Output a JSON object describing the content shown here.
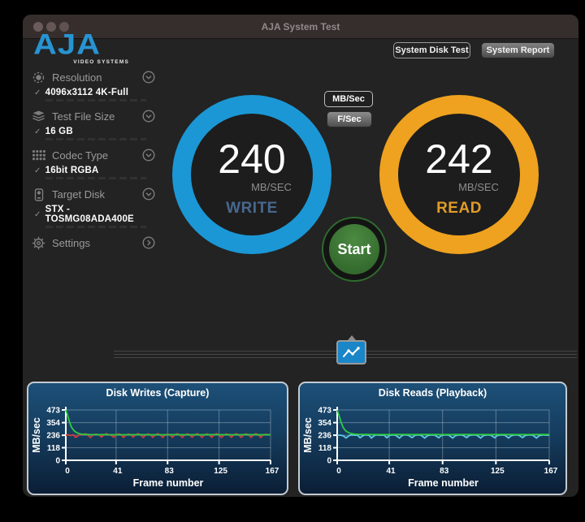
{
  "window": {
    "title": "AJA System Test"
  },
  "brand": {
    "name": "AJA",
    "tagline": "VIDEO SYSTEMS"
  },
  "header": {
    "system_disk_test_label": "System Disk Test",
    "system_report_label": "System Report"
  },
  "icons": {
    "check_glyph": "✓"
  },
  "sidebar": {
    "items": [
      {
        "label": "Resolution",
        "icon": "chip-icon",
        "value": "4096x3112 4K-Full",
        "chevron": "down"
      },
      {
        "label": "Test File Size",
        "icon": "layers-icon",
        "value": "16 GB",
        "chevron": "down"
      },
      {
        "label": "Codec Type",
        "icon": "grid-icon",
        "value": "16bit RGBA",
        "chevron": "down"
      },
      {
        "label": "Target Disk",
        "icon": "disk-icon",
        "value": "STX - TOSMG08ADA400E",
        "chevron": "down"
      },
      {
        "label": "Settings",
        "icon": "gear-icon",
        "value": null,
        "chevron": "right"
      }
    ]
  },
  "unit_buttons": {
    "mbsec_label": "MB/Sec",
    "fsec_label": "F/Sec"
  },
  "gauges": {
    "write": {
      "value": "240",
      "unit": "MB/SEC",
      "label": "WRITE",
      "ring_color": "#1b97d5",
      "label_color": "#47688f"
    },
    "read": {
      "value": "242",
      "unit": "MB/SEC",
      "label": "READ",
      "ring_color": "#efa21f",
      "label_color": "#e09c28"
    }
  },
  "start_button": {
    "label": "Start",
    "color": "#3e7c36"
  },
  "chart_data": [
    {
      "type": "line",
      "title": "Disk Writes (Capture)",
      "xlabel": "Frame number",
      "ylabel": "MB/sec",
      "xlim": [
        0,
        167
      ],
      "ylim": [
        0,
        473
      ],
      "xticks": [
        0,
        41,
        83,
        125,
        167
      ],
      "yticks": [
        0,
        118,
        236,
        354,
        473
      ],
      "grid": true,
      "legend": "none",
      "series": [
        {
          "name": "write-instant",
          "color": "#d03a3a",
          "points": [
            [
              0,
              236
            ],
            [
              2,
              240
            ],
            [
              4,
              233
            ],
            [
              6,
              241
            ],
            [
              8,
              214
            ],
            [
              10,
              231
            ],
            [
              12,
              243
            ],
            [
              14,
              238
            ],
            [
              16,
              250
            ],
            [
              18,
              236
            ],
            [
              20,
              214
            ],
            [
              22,
              236
            ],
            [
              24,
              246
            ],
            [
              27,
              240
            ],
            [
              29,
              218
            ],
            [
              31,
              238
            ],
            [
              33,
              250
            ],
            [
              35,
              240
            ],
            [
              37,
              235
            ],
            [
              39,
              216
            ],
            [
              41,
              238
            ],
            [
              43,
              249
            ],
            [
              45,
              241
            ],
            [
              47,
              214
            ],
            [
              49,
              236
            ],
            [
              51,
              248
            ],
            [
              53,
              239
            ],
            [
              55,
              218
            ],
            [
              57,
              241
            ],
            [
              59,
              250
            ],
            [
              61,
              238
            ],
            [
              63,
              214
            ],
            [
              65,
              236
            ],
            [
              67,
              248
            ],
            [
              69,
              240
            ],
            [
              71,
              216
            ],
            [
              73,
              238
            ],
            [
              75,
              250
            ],
            [
              77,
              239
            ],
            [
              79,
              214
            ],
            [
              81,
              236
            ],
            [
              83,
              248
            ],
            [
              85,
              238
            ],
            [
              87,
              216
            ],
            [
              89,
              240
            ],
            [
              91,
              250
            ],
            [
              93,
              238
            ],
            [
              95,
              214
            ],
            [
              97,
              238
            ],
            [
              99,
              248
            ],
            [
              101,
              240
            ],
            [
              103,
              216
            ],
            [
              105,
              238
            ],
            [
              107,
              250
            ],
            [
              109,
              239
            ],
            [
              111,
              214
            ],
            [
              113,
              238
            ],
            [
              115,
              248
            ],
            [
              117,
              238
            ],
            [
              119,
              216
            ],
            [
              121,
              240
            ],
            [
              123,
              250
            ],
            [
              125,
              238
            ],
            [
              127,
              214
            ],
            [
              129,
              238
            ],
            [
              131,
              248
            ],
            [
              133,
              240
            ],
            [
              135,
              216
            ],
            [
              137,
              238
            ],
            [
              139,
              250
            ],
            [
              141,
              238
            ],
            [
              143,
              214
            ],
            [
              145,
              238
            ],
            [
              147,
              248
            ],
            [
              149,
              240
            ],
            [
              151,
              216
            ],
            [
              153,
              238
            ],
            [
              155,
              250
            ],
            [
              157,
              240
            ],
            [
              159,
              214
            ],
            [
              161,
              238
            ],
            [
              163,
              246
            ],
            [
              165,
              240
            ],
            [
              167,
              238
            ]
          ]
        },
        {
          "name": "write-average",
          "color": "#2ecc40",
          "points": [
            [
              0,
              473
            ],
            [
              1,
              440
            ],
            [
              2,
              400
            ],
            [
              3,
              362
            ],
            [
              4,
              330
            ],
            [
              5,
              305
            ],
            [
              6,
              288
            ],
            [
              7,
              275
            ],
            [
              8,
              266
            ],
            [
              10,
              254
            ],
            [
              12,
              248
            ],
            [
              14,
              245
            ],
            [
              17,
              243
            ],
            [
              20,
              242
            ],
            [
              25,
              241
            ],
            [
              30,
              241
            ],
            [
              40,
              240
            ],
            [
              50,
              240
            ],
            [
              60,
              241
            ],
            [
              70,
              240
            ],
            [
              80,
              240
            ],
            [
              90,
              241
            ],
            [
              100,
              240
            ],
            [
              110,
              240
            ],
            [
              120,
              241
            ],
            [
              130,
              240
            ],
            [
              140,
              240
            ],
            [
              150,
              241
            ],
            [
              160,
              240
            ],
            [
              167,
              240
            ]
          ]
        }
      ]
    },
    {
      "type": "line",
      "title": "Disk Reads (Playback)",
      "xlabel": "Frame number",
      "ylabel": "MB/sec",
      "xlim": [
        0,
        167
      ],
      "ylim": [
        0,
        473
      ],
      "xticks": [
        0,
        41,
        83,
        125,
        167
      ],
      "yticks": [
        0,
        118,
        236,
        354,
        473
      ],
      "grid": true,
      "legend": "none",
      "series": [
        {
          "name": "read-instant",
          "color": "#5fc8e8",
          "points": [
            [
              0,
              236
            ],
            [
              3,
              236
            ],
            [
              5,
              229
            ],
            [
              7,
              209
            ],
            [
              9,
              230
            ],
            [
              11,
              239
            ],
            [
              14,
              236
            ],
            [
              16,
              236
            ],
            [
              18,
              211
            ],
            [
              20,
              230
            ],
            [
              22,
              239
            ],
            [
              25,
              236
            ],
            [
              27,
              209
            ],
            [
              29,
              230
            ],
            [
              31,
              239
            ],
            [
              34,
              236
            ],
            [
              37,
              236
            ],
            [
              39,
              211
            ],
            [
              41,
              232
            ],
            [
              43,
              239
            ],
            [
              46,
              236
            ],
            [
              49,
              209
            ],
            [
              51,
              231
            ],
            [
              53,
              239
            ],
            [
              56,
              236
            ],
            [
              59,
              213
            ],
            [
              61,
              233
            ],
            [
              63,
              239
            ],
            [
              66,
              236
            ],
            [
              69,
              209
            ],
            [
              71,
              231
            ],
            [
              74,
              239
            ],
            [
              77,
              236
            ],
            [
              80,
              211
            ],
            [
              82,
              233
            ],
            [
              85,
              239
            ],
            [
              88,
              236
            ],
            [
              91,
              209
            ],
            [
              93,
              231
            ],
            [
              96,
              239
            ],
            [
              99,
              236
            ],
            [
              102,
              213
            ],
            [
              104,
              233
            ],
            [
              107,
              239
            ],
            [
              110,
              236
            ],
            [
              113,
              209
            ],
            [
              115,
              231
            ],
            [
              118,
              239
            ],
            [
              121,
              236
            ],
            [
              124,
              211
            ],
            [
              126,
              233
            ],
            [
              129,
              239
            ],
            [
              132,
              236
            ],
            [
              135,
              209
            ],
            [
              137,
              231
            ],
            [
              140,
              239
            ],
            [
              143,
              236
            ],
            [
              146,
              213
            ],
            [
              148,
              233
            ],
            [
              151,
              239
            ],
            [
              154,
              236
            ],
            [
              157,
              209
            ],
            [
              159,
              231
            ],
            [
              162,
              239
            ],
            [
              165,
              236
            ],
            [
              167,
              236
            ]
          ]
        },
        {
          "name": "read-average",
          "color": "#2ecc40",
          "points": [
            [
              0,
              473
            ],
            [
              1,
              438
            ],
            [
              2,
              398
            ],
            [
              3,
              360
            ],
            [
              4,
              328
            ],
            [
              5,
              304
            ],
            [
              6,
              287
            ],
            [
              7,
              275
            ],
            [
              8,
              266
            ],
            [
              10,
              255
            ],
            [
              12,
              249
            ],
            [
              14,
              246
            ],
            [
              17,
              244
            ],
            [
              20,
              243
            ],
            [
              25,
              243
            ],
            [
              30,
              242
            ],
            [
              40,
              242
            ],
            [
              50,
              243
            ],
            [
              60,
              242
            ],
            [
              70,
              243
            ],
            [
              80,
              242
            ],
            [
              90,
              242
            ],
            [
              100,
              243
            ],
            [
              110,
              242
            ],
            [
              120,
              242
            ],
            [
              130,
              243
            ],
            [
              140,
              242
            ],
            [
              150,
              242
            ],
            [
              160,
              243
            ],
            [
              167,
              242
            ]
          ]
        }
      ]
    }
  ]
}
